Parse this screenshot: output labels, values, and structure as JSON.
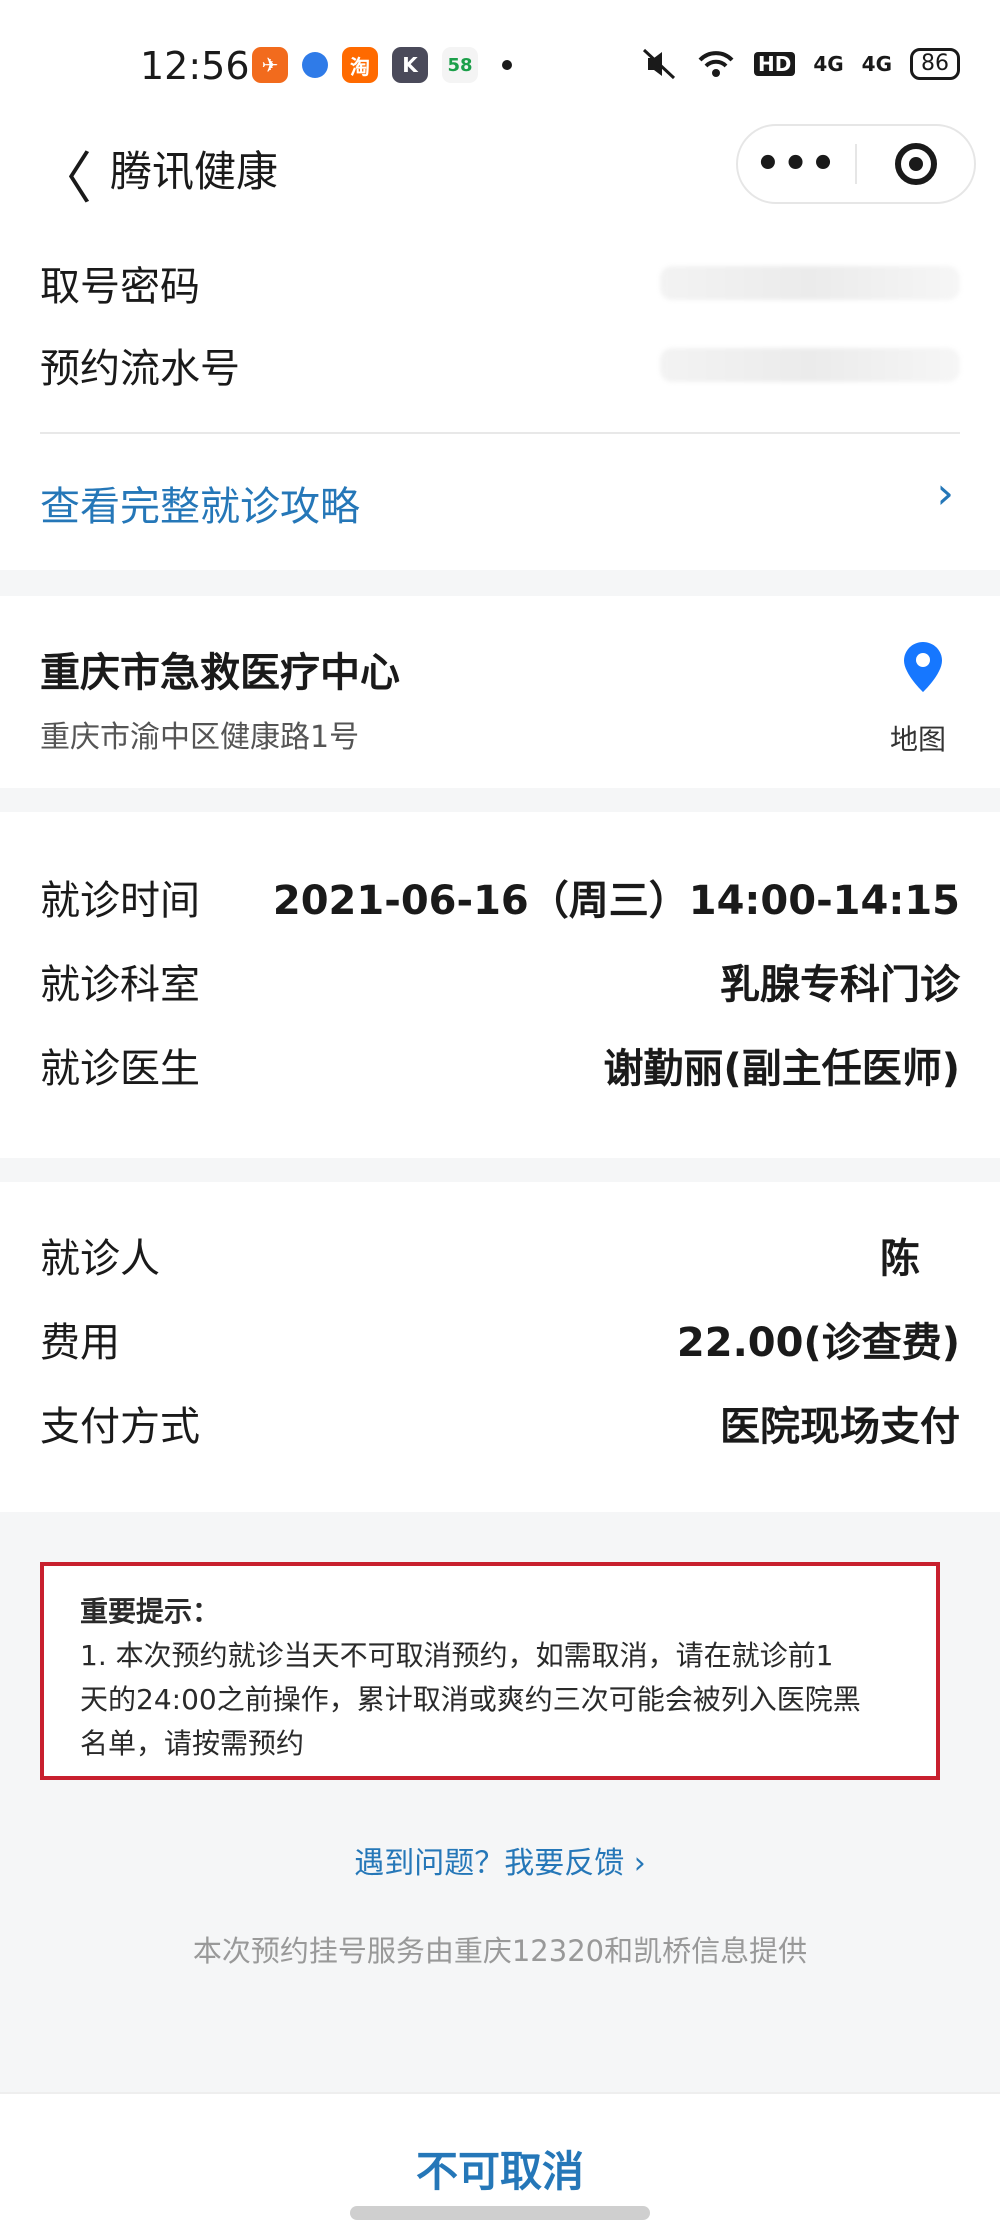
{
  "status": {
    "time": "12:56",
    "battery": "86",
    "network_a": "4G",
    "network_b": "4G",
    "hd": "HD",
    "app_icons": [
      "feishu-icon",
      "circle-app-icon",
      "taobao-icon",
      "k-app-icon",
      "58-app-icon"
    ]
  },
  "nav": {
    "back_glyph": "〈",
    "title": "腾讯健康",
    "more_glyph": "•••"
  },
  "ticket": {
    "password_label": "取号密码",
    "serial_label": "预约流水号",
    "guide_link": "查看完整就诊攻略",
    "guide_chevron": "›"
  },
  "hospital": {
    "name": "重庆市急救医疗中心",
    "address": "重庆市渝中区健康路1号",
    "map_label": "地图"
  },
  "visit": {
    "time_label": "就诊时间",
    "time_value": "2021-06-16（周三）14:00-14:15",
    "dept_label": "就诊科室",
    "dept_value": "乳腺专科门诊",
    "doctor_label": "就诊医生",
    "doctor_value": "谢勤丽(副主任医师)"
  },
  "patient": {
    "name_label": "就诊人",
    "name_value": "陈",
    "fee_label": "费用",
    "fee_value": "22.00(诊查费)",
    "pay_label": "支付方式",
    "pay_value": "医院现场支付"
  },
  "notice": {
    "title": "重要提示：",
    "line1": "1.   本次预约就诊当天不可取消预约，如需取消，请在就诊前1",
    "line2": "天的24:00之前操作，累计取消或爽约三次可能会被列入医院黑",
    "line3": "名单，请按需预约",
    "highlight_color": "#c8202e"
  },
  "footer": {
    "feedback_link": "遇到问题？我要反馈 ›",
    "provider": "本次预约挂号服务由重庆12320和凯桥信息提供",
    "cancel_button": "不可取消"
  },
  "colors": {
    "accent": "#2577b8",
    "map_pin": "#1677ff"
  }
}
